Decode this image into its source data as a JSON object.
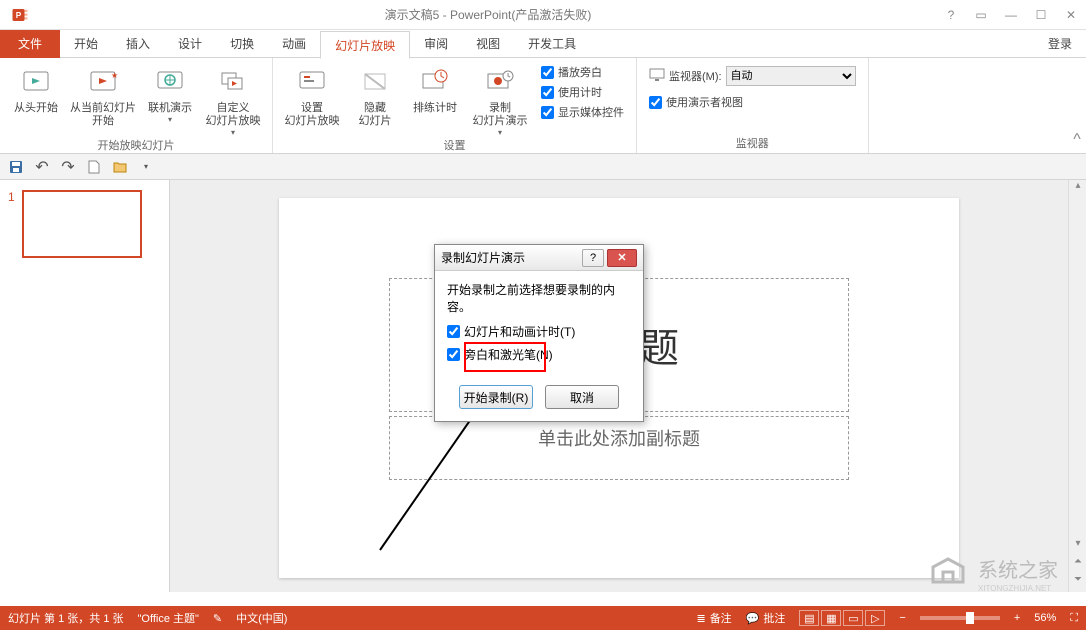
{
  "app": {
    "title": "演示文稿5 - PowerPoint(产品激活失败)"
  },
  "tabs": {
    "file": "文件",
    "home": "开始",
    "insert": "插入",
    "design": "设计",
    "transitions": "切换",
    "animations": "动画",
    "slideshow": "幻灯片放映",
    "review": "审阅",
    "view": "视图",
    "developer": "开发工具",
    "login": "登录"
  },
  "ribbon": {
    "from_beginning": "从头开始",
    "from_current": "从当前幻灯片\n开始",
    "present_online": "联机演示",
    "custom_show": "自定义\n幻灯片放映",
    "group1": "开始放映幻灯片",
    "setup_show": "设置\n幻灯片放映",
    "hide_slide": "隐藏\n幻灯片",
    "rehearse": "排练计时",
    "record": "录制\n幻灯片演示",
    "play_narr": "播放旁白",
    "use_timings": "使用计时",
    "show_media": "显示媒体控件",
    "group2": "设置",
    "monitor_label": "监视器(M):",
    "monitor_value": "自动",
    "presenter_view": "使用演示者视图",
    "group3": "监视器"
  },
  "slide": {
    "number": "1",
    "title_placeholder": "加标题",
    "subtitle_placeholder": "单击此处添加副标题"
  },
  "dialog": {
    "title": "录制幻灯片演示",
    "prompt": "开始录制之前选择想要录制的内容。",
    "opt1": "幻灯片和动画计时(T)",
    "opt2": "旁白和激光笔(N)",
    "start": "开始录制(R)",
    "cancel": "取消"
  },
  "status": {
    "slide_info": "幻灯片 第 1 张，共 1 张",
    "theme": "\"Office 主题\"",
    "lang": "中文(中国)",
    "notes": "备注",
    "comments": "批注",
    "zoom": "56%"
  },
  "watermark": "系统之家"
}
